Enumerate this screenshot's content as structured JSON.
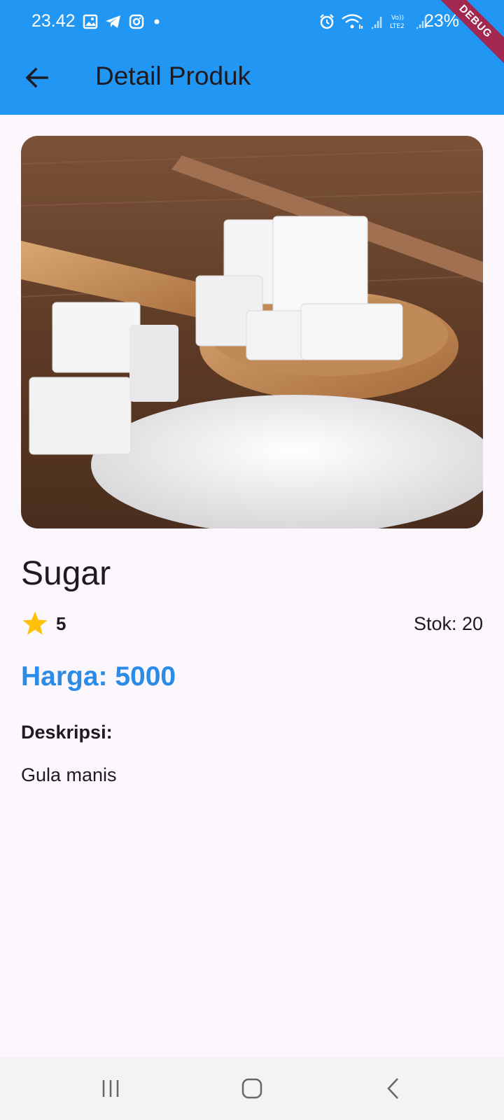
{
  "status_bar": {
    "time": "23.42",
    "battery": "23%",
    "debug_banner": "DEBUG"
  },
  "app_bar": {
    "title": "Detail Produk",
    "back_icon": "arrow-left-icon"
  },
  "product": {
    "name": "Sugar",
    "rating": "5",
    "stock": "Stok: 20",
    "price": "Harga: 5000",
    "description_label": "Deskripsi:",
    "description": "Gula manis"
  },
  "colors": {
    "app_bar": "#2196f3",
    "price": "#2a8ce6",
    "star": "#ffc107",
    "background": "#fcf6fd"
  },
  "nav_bar": {
    "icons": [
      "recents-icon",
      "home-icon",
      "back-icon"
    ]
  }
}
